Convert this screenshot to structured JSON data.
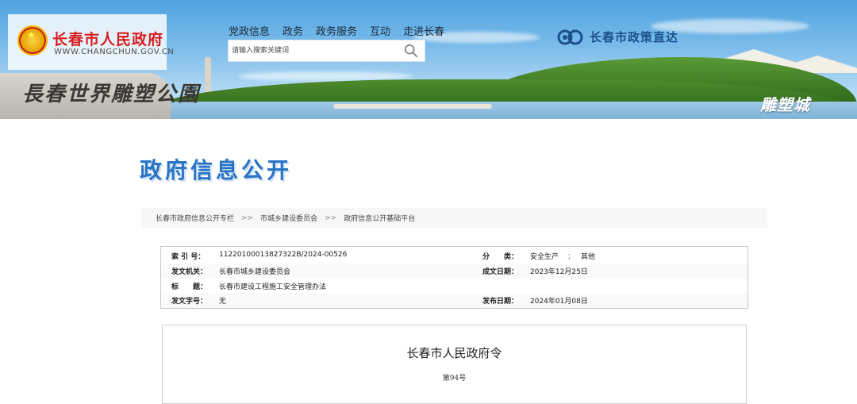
{
  "header": {
    "site_name": "长春市人民政府",
    "site_url": "WWW.CHANGCHUN.GOV.CN",
    "nav_items": [
      "党政信息",
      "政务",
      "政务服务",
      "互动",
      "走进长春"
    ],
    "search_placeholder": "请输入搜索关键词",
    "policy_label": "长春市政策直达",
    "banner_stone_text": "長春世界雕塑公園",
    "banner_sculpture_text": "雕塑城"
  },
  "section_title": "政府信息公开",
  "breadcrumb": [
    "长春市政府信息公开专栏",
    "市城乡建设委员会",
    "政府信息公开基础平台"
  ],
  "breadcrumb_separator": ">>",
  "meta": {
    "index_label": "索 引 号：",
    "index_value": "11220100013827322B/2024-00526",
    "category_label": "分　　类：",
    "category_value_1": "安全生产",
    "category_sep": "；",
    "category_value_2": "其他",
    "issuer_label": "发文机关：",
    "issuer_value": "长春市城乡建设委员会",
    "created_label": "成文日期：",
    "created_value": "2023年12月25日",
    "title_label": "标　　题：",
    "title_value": "长春市建设工程施工安全管理办法",
    "docno_label": "发文字号：",
    "docno_value": "无",
    "published_label": "发布日期：",
    "published_value": "2024年01月08日"
  },
  "document": {
    "heading": "长春市人民政府令",
    "number": "第94号"
  },
  "colors": {
    "title_blue": "#2a74c5",
    "site_red": "#d71d1d",
    "policy_blue": "#1c4f8c"
  }
}
